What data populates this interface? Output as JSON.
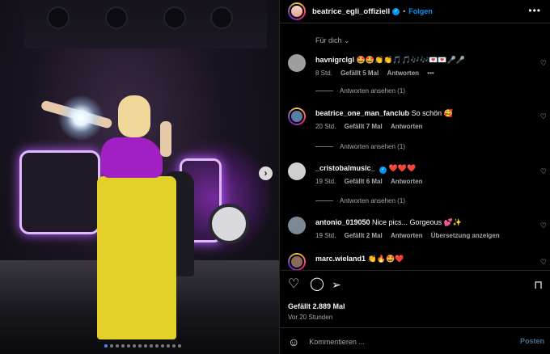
{
  "post": {
    "username": "beatrice_egli_offiziell",
    "separator": "•",
    "follow_label": "Folgen",
    "more_label": "•••",
    "next_label": "›"
  },
  "carousel": {
    "total": 14,
    "active_index": 0
  },
  "comments_filter": "Für dich ⌄",
  "comments": [
    {
      "username": "havnigrclgl",
      "text": "🤩🤩👏👏🎵🎵🎶🎶💌💌🎤🎤",
      "time": "8 Std.",
      "likes": "Gefällt 5 Mal",
      "reply_label": "Antworten",
      "extra": "•••",
      "view_replies": "Antworten ansehen (1)"
    },
    {
      "username": "beatrice_one_man_fanclub",
      "text": "So schön 🥰",
      "time": "20 Std.",
      "likes": "Gefällt 7 Mal",
      "reply_label": "Antworten",
      "view_replies": "Antworten ansehen (1)"
    },
    {
      "username": "_cristobalmusic_",
      "text": "❤️❤️❤️",
      "time": "19 Std.",
      "likes": "Gefällt 6 Mal",
      "reply_label": "Antworten",
      "view_replies": "Antworten ansehen (1)"
    },
    {
      "username": "antonio_019050",
      "text": "Nice pics... Gorgeous 💕✨",
      "time": "19 Std.",
      "likes": "Gefällt 2 Mal",
      "reply_label": "Antworten",
      "translate_label": "Übersetzung anzeigen"
    },
    {
      "username": "marc.wieland1",
      "text": "👏🔥🤩❤️"
    }
  ],
  "actions": {
    "like_icon": "heart-icon",
    "comment_icon": "comment-icon",
    "share_icon": "share-icon",
    "save_icon": "bookmark-icon",
    "likes_text": "Gefällt 2.889 Mal",
    "time_ago": "Vor 20 Stunden"
  },
  "composer": {
    "placeholder": "Kommentieren ...",
    "post_label": "Posten"
  },
  "colors": {
    "accent": "#0095f6",
    "background": "#000000",
    "muted": "#a8a8a8"
  }
}
